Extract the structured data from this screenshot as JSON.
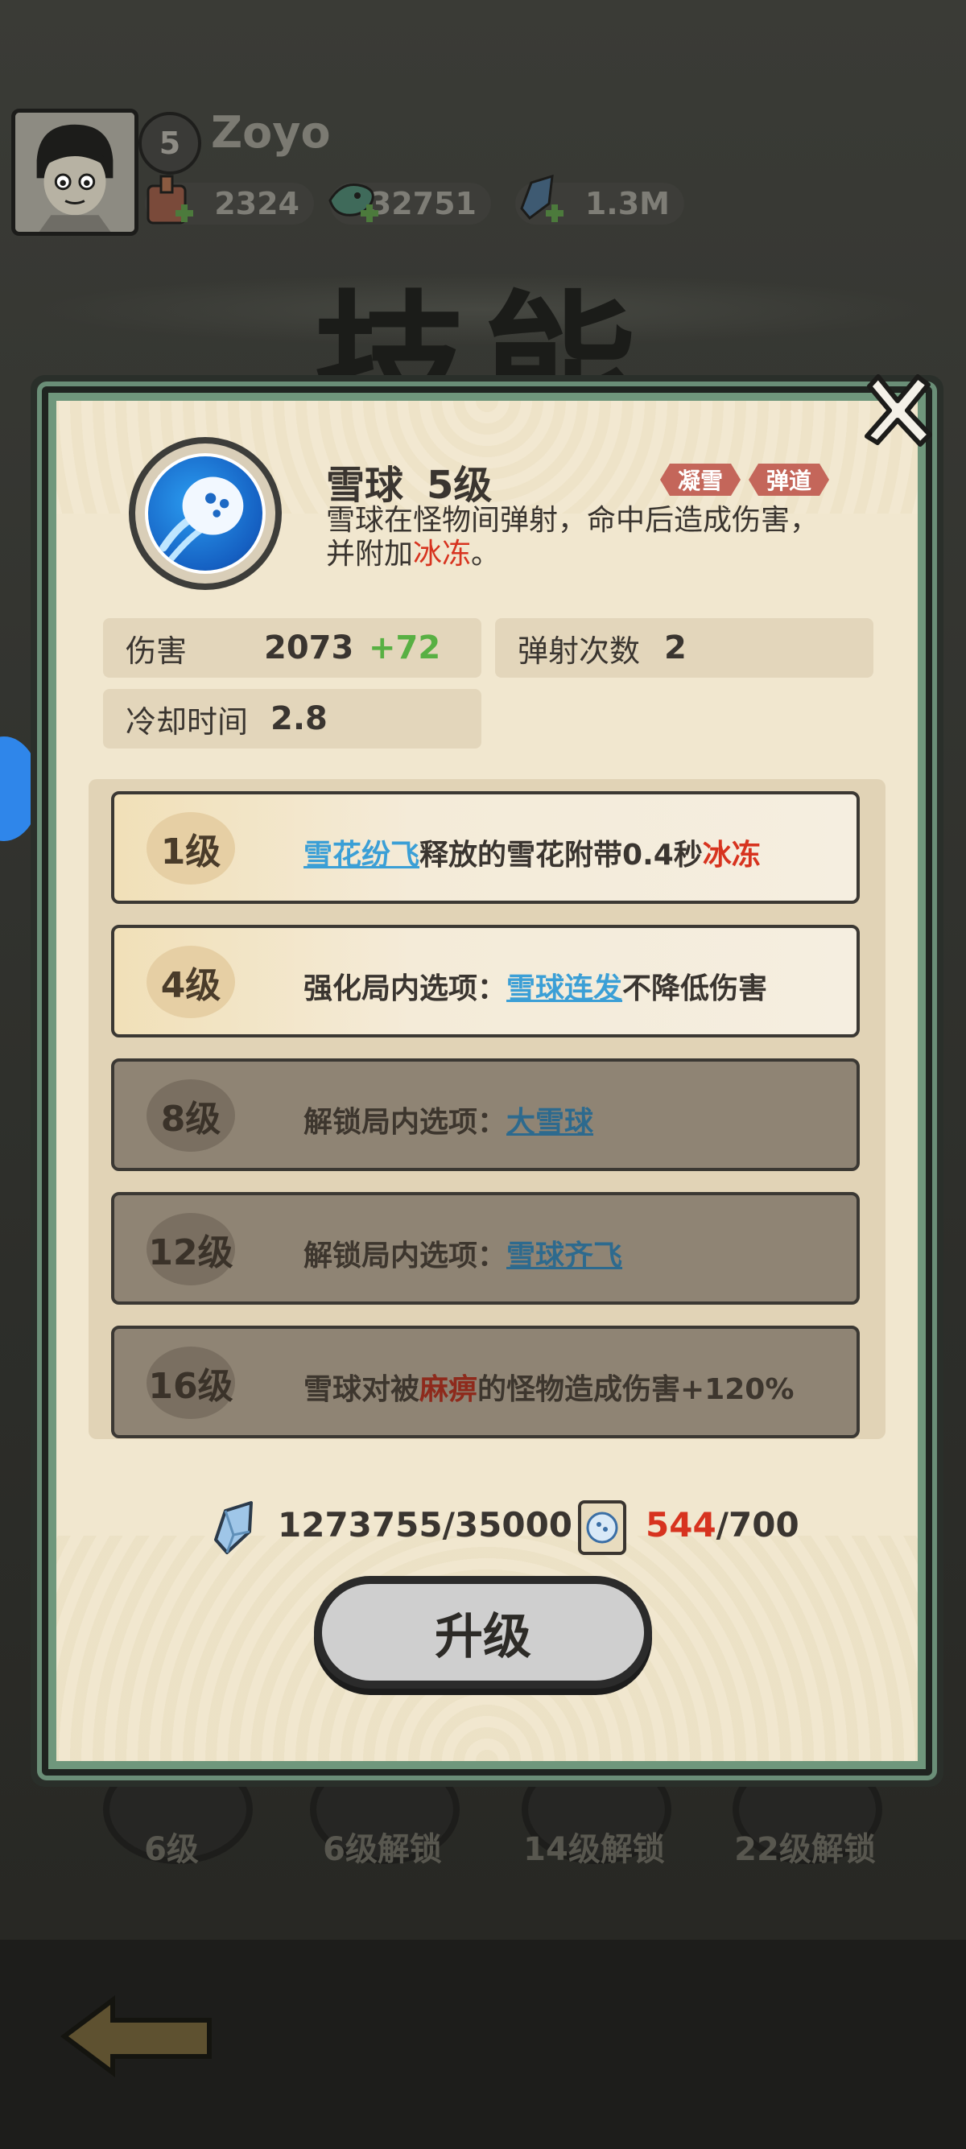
{
  "header": {
    "level": "5",
    "username": "Zoyo",
    "resources": [
      {
        "icon": "gift-bag-icon",
        "value": "2324"
      },
      {
        "icon": "dragon-token-icon",
        "value": "32751"
      },
      {
        "icon": "crystal-icon",
        "value": "1.3M"
      }
    ],
    "page_title": "技能"
  },
  "skill": {
    "name": "雪球",
    "level": "5级",
    "tags": [
      "凝雪",
      "弹道"
    ],
    "desc_prefix": "雪球在怪物间弹射，命中后造成伤害，并附加",
    "desc_highlight": "冰冻",
    "desc_suffix": "。"
  },
  "stats": {
    "damage_label": "伤害",
    "damage_value": "2073",
    "damage_bonus": "+72",
    "bounce_label": "弹射次数",
    "bounce_value": "2",
    "cooldown_label": "冷却时间",
    "cooldown_value": "2.8"
  },
  "upgrades": [
    {
      "level": "1级",
      "state": "unlocked",
      "link": "雪花纷飞",
      "text_after": "释放的雪花附带0.4秒",
      "red": "冰冻"
    },
    {
      "level": "4级",
      "state": "unlocked",
      "prefix": "强化局内选项：",
      "link": "雪球连发",
      "text_after": "不降低伤害"
    },
    {
      "level": "8级",
      "state": "locked",
      "prefix": "解锁局内选项：",
      "link": "大雪球"
    },
    {
      "level": "12级",
      "state": "locked",
      "prefix": "解锁局内选项：",
      "link": "雪球齐飞"
    },
    {
      "level": "16级",
      "state": "locked",
      "prefix": "雪球对被",
      "red": "麻痹",
      "text_after": "的怪物造成伤害+120%"
    }
  ],
  "cost": {
    "crystal": "1273755/35000",
    "scroll_current": "544",
    "scroll_total": "/700"
  },
  "upgrade_button": "升级",
  "bottom_slots": [
    "6级",
    "6级解锁",
    "14级解锁",
    "22级解锁"
  ]
}
